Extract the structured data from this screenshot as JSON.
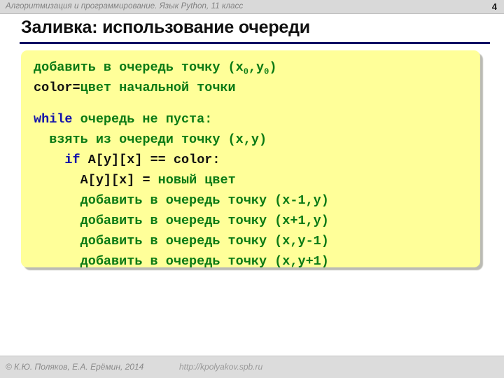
{
  "header": {
    "course_title": "Алгоритмизация и программирование. Язык Python, 11 класс",
    "page_number": "4"
  },
  "slide": {
    "title": "Заливка: использование очереди",
    "rule_color": "#101064"
  },
  "code_panel": {
    "background_color": "#ffff99",
    "keyword_color": "#1111aa",
    "pseudocode_color": "#0a7a14",
    "code_color": "#101010",
    "lines": [
      {
        "id": "line-enqueue-start",
        "indent": 0,
        "segments": [
          {
            "text": "добавить в очередь точку (x",
            "style": "green"
          },
          {
            "text": "0",
            "style": "green-sub"
          },
          {
            "text": ",y",
            "style": "green"
          },
          {
            "text": "0",
            "style": "green-sub"
          },
          {
            "text": ")",
            "style": "green"
          }
        ]
      },
      {
        "id": "line-color-assign",
        "indent": 0,
        "segments": [
          {
            "text": "color",
            "style": "black"
          },
          {
            "text": "=",
            "style": "black"
          },
          {
            "text": "цвет начальной точки",
            "style": "green"
          }
        ]
      },
      {
        "id": "line-blank",
        "indent": 0,
        "blank": true,
        "segments": []
      },
      {
        "id": "line-while",
        "indent": 0,
        "segments": [
          {
            "text": "while",
            "style": "blue"
          },
          {
            "text": " очередь не пуста:",
            "style": "green"
          }
        ]
      },
      {
        "id": "line-dequeue",
        "indent": 1,
        "segments": [
          {
            "text": "взять из очереди точку (x,y)",
            "style": "green"
          }
        ]
      },
      {
        "id": "line-if",
        "indent": 2,
        "segments": [
          {
            "text": "if",
            "style": "blue"
          },
          {
            "text": " A[y][x] ",
            "style": "black"
          },
          {
            "text": "==",
            "style": "black"
          },
          {
            "text": " color:",
            "style": "black"
          }
        ]
      },
      {
        "id": "line-set-color",
        "indent": 3,
        "segments": [
          {
            "text": "A[y][x] = ",
            "style": "black"
          },
          {
            "text": "новый цвет",
            "style": "green"
          }
        ]
      },
      {
        "id": "line-enqueue-left",
        "indent": 3,
        "segments": [
          {
            "text": "добавить в очередь точку (x-1,y)",
            "style": "green"
          }
        ]
      },
      {
        "id": "line-enqueue-right",
        "indent": 3,
        "segments": [
          {
            "text": "добавить в очередь точку (x+1,y)",
            "style": "green"
          }
        ]
      },
      {
        "id": "line-enqueue-up",
        "indent": 3,
        "segments": [
          {
            "text": "добавить в очередь точку (x,y-1)",
            "style": "green"
          }
        ]
      },
      {
        "id": "line-enqueue-down",
        "indent": 3,
        "segments": [
          {
            "text": "добавить в очередь точку (x,y+1)",
            "style": "green"
          }
        ]
      }
    ]
  },
  "footer": {
    "copyright": "© К.Ю. Поляков, Е.А. Ерёмин, 2014",
    "url": "http://kpolyakov.spb.ru"
  }
}
